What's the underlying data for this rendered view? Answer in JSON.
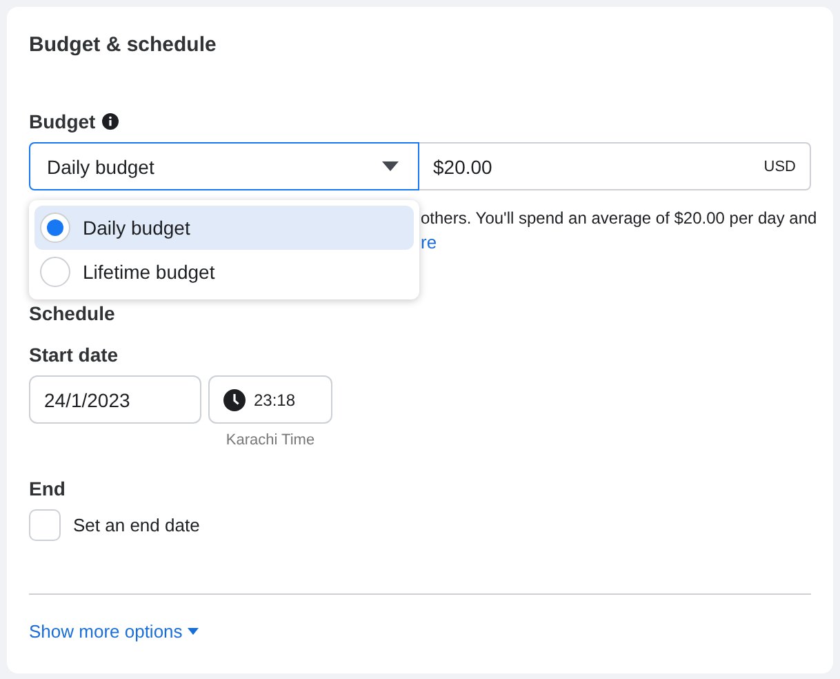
{
  "title": "Budget & schedule",
  "budget": {
    "label": "Budget",
    "select_value": "Daily budget",
    "amount": "$20.00",
    "currency": "USD",
    "hint": "others. You'll spend an average of $20.00 per day and",
    "hint_link": "re",
    "options": [
      {
        "label": "Daily budget",
        "selected": true
      },
      {
        "label": "Lifetime budget",
        "selected": false
      }
    ]
  },
  "schedule": {
    "label": "Schedule",
    "start_label": "Start date",
    "date": "24/1/2023",
    "time": "23:18",
    "timezone": "Karachi Time",
    "end_label": "End",
    "end_checkbox": {
      "label": "Set an end date",
      "checked": false
    }
  },
  "show_more": "Show more options"
}
